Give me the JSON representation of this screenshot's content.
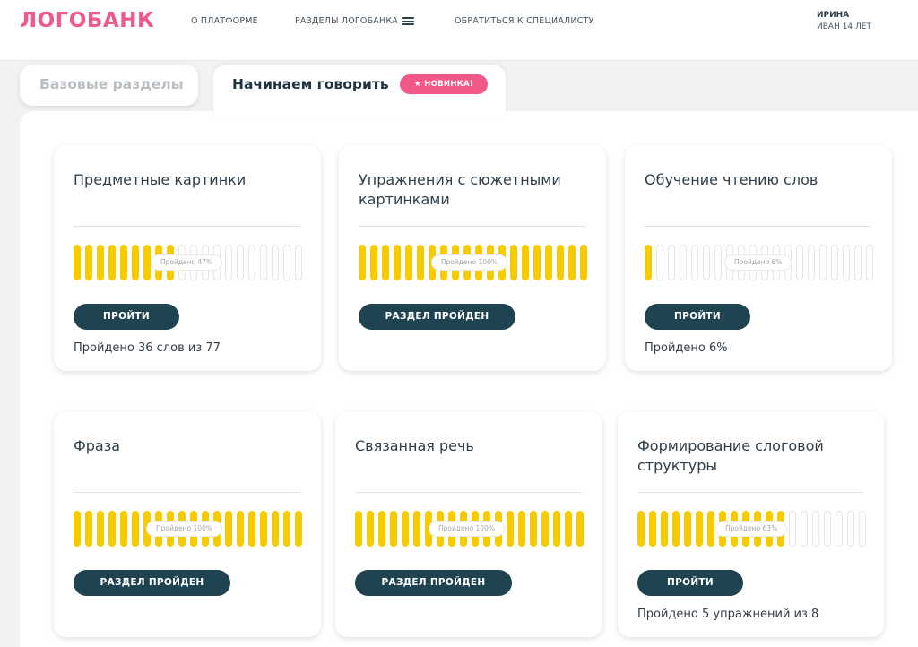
{
  "header": {
    "logo": "ЛОГОБАНК",
    "nav": [
      {
        "label": "О ПЛАТФОРМЕ"
      },
      {
        "label": "РАЗДЕЛЫ ЛОГОБАНКА"
      },
      {
        "label": "ОБРАТИТЬСЯ К СПЕЦИАЛИСТУ"
      }
    ],
    "user": {
      "name": "ИРИНА",
      "child": "ИВАН 14 ЛЕТ"
    }
  },
  "tabs": [
    {
      "label": "Базовые разделы",
      "active": false
    },
    {
      "label": "Начинаем говорить",
      "active": true,
      "badge": "★ НОВИНКА!"
    }
  ],
  "colors": {
    "brand": "#ee5b8a",
    "badge": "#f25887",
    "progress_fill": "#f6cc00",
    "button": "#1f4350"
  },
  "cards": [
    {
      "title": "Предметные картинки",
      "progress_label": "Пройдено 47%",
      "progress": 0.47,
      "button": "ПРОЙТИ",
      "footer": "Пройдено 36 слов из 77"
    },
    {
      "title": "Упражнения с сюжетными картинками",
      "progress_label": "Пройдено 100%",
      "progress": 1.0,
      "button": "РАЗДЕЛ ПРОЙДЕН",
      "footer": ""
    },
    {
      "title": "Обучение чтению слов",
      "progress_label": "Пройдено 6%",
      "progress": 0.06,
      "button": "ПРОЙТИ",
      "footer": "Пройдено 6%"
    },
    {
      "title": "Фраза",
      "progress_label": "Пройдено 100%",
      "progress": 1.0,
      "button": "РАЗДЕЛ ПРОЙДЕН",
      "footer": ""
    },
    {
      "title": "Связанная речь",
      "progress_label": "Пройдено 100%",
      "progress": 1.0,
      "button": "РАЗДЕЛ ПРОЙДЕН",
      "footer": ""
    },
    {
      "title": "Формирование слоговой структуры",
      "progress_label": "Пройдено 63%",
      "progress": 0.63,
      "button": "ПРОЙТИ",
      "footer": "Пройдено 5 упражнений из 8"
    }
  ]
}
